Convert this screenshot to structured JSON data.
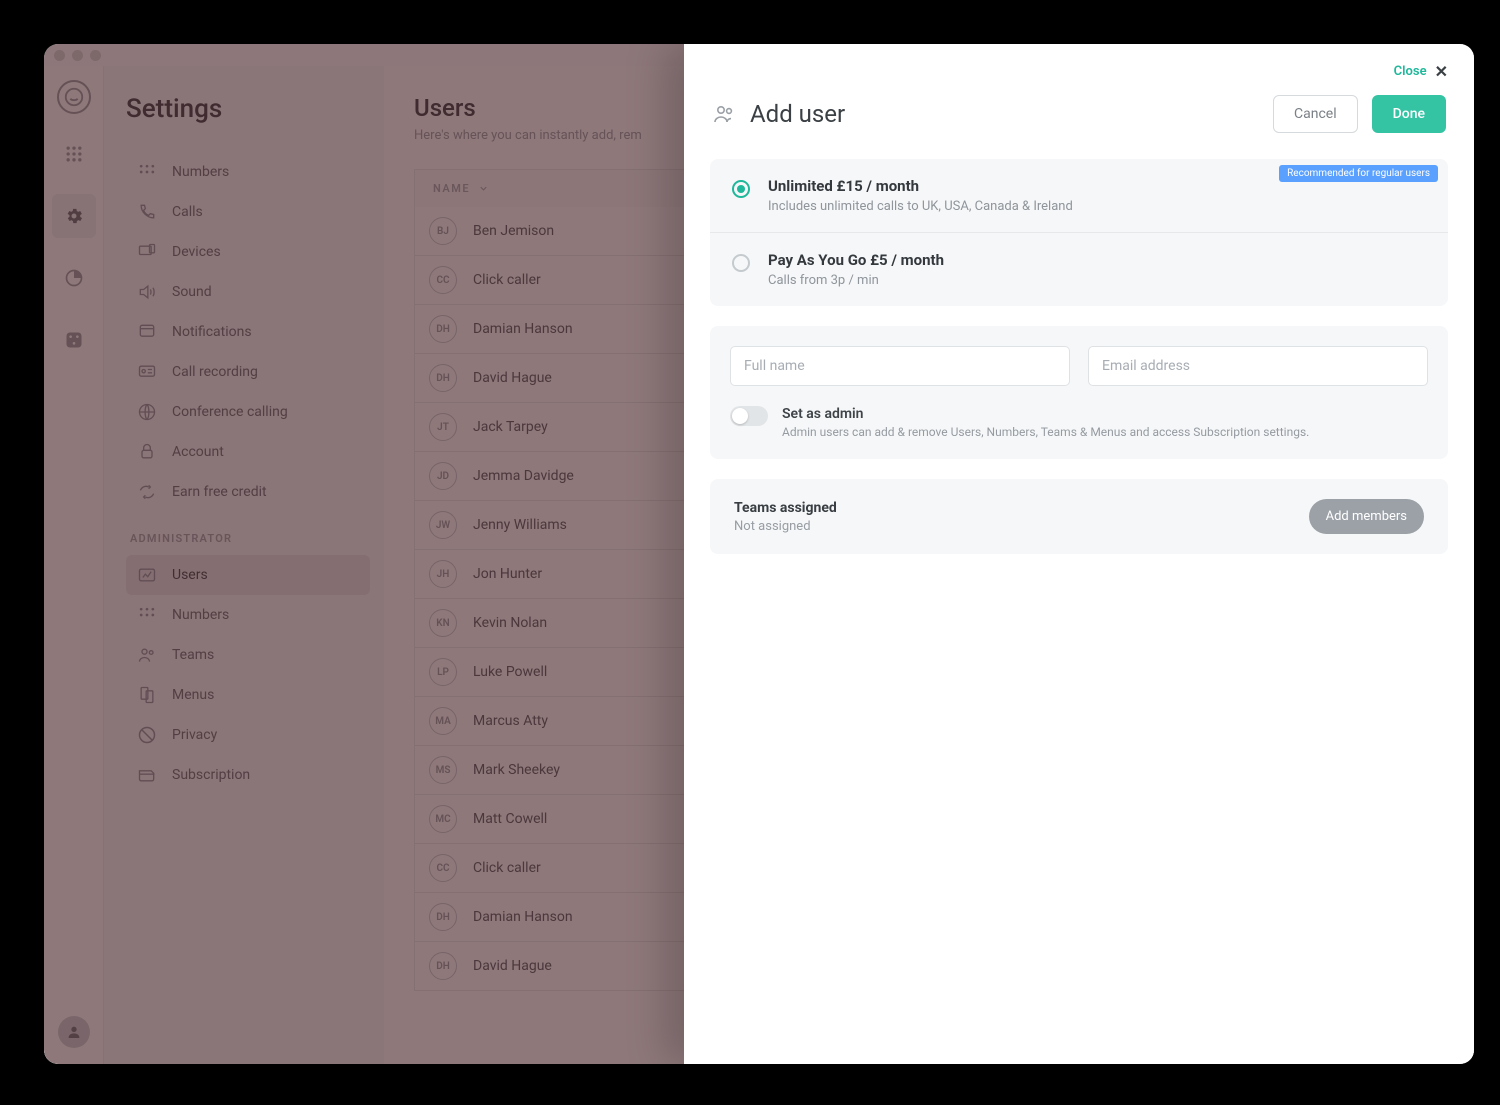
{
  "settings": {
    "title": "Settings",
    "items": [
      "Numbers",
      "Calls",
      "Devices",
      "Sound",
      "Notifications",
      "Call recording",
      "Conference calling",
      "Account",
      "Earn free credit"
    ],
    "admin_label": "ADMINISTRATOR",
    "admin_items": [
      "Users",
      "Numbers",
      "Teams",
      "Menus",
      "Privacy",
      "Subscription"
    ],
    "admin_active_index": 0
  },
  "users_page": {
    "title": "Users",
    "subtitle": "Here's where you can instantly add, rem",
    "column_header": "NAME",
    "rows": [
      {
        "initials": "BJ",
        "name": "Ben Jemison"
      },
      {
        "initials": "CC",
        "name": "Click caller"
      },
      {
        "initials": "DH",
        "name": "Damian Hanson"
      },
      {
        "initials": "DH",
        "name": "David Hague"
      },
      {
        "initials": "JT",
        "name": "Jack Tarpey"
      },
      {
        "initials": "JD",
        "name": "Jemma Davidge"
      },
      {
        "initials": "JW",
        "name": "Jenny Williams"
      },
      {
        "initials": "JH",
        "name": "Jon Hunter"
      },
      {
        "initials": "KN",
        "name": "Kevin Nolan"
      },
      {
        "initials": "LP",
        "name": "Luke Powell"
      },
      {
        "initials": "MA",
        "name": "Marcus Atty"
      },
      {
        "initials": "MS",
        "name": "Mark Sheekey"
      },
      {
        "initials": "MC",
        "name": "Matt Cowell"
      },
      {
        "initials": "CC",
        "name": "Click caller"
      },
      {
        "initials": "DH",
        "name": "Damian Hanson"
      },
      {
        "initials": "DH",
        "name": "David Hague"
      }
    ]
  },
  "modal": {
    "close": "Close",
    "title": "Add user",
    "cancel": "Cancel",
    "done": "Done",
    "recommended_badge": "Recommended for regular users",
    "plans": [
      {
        "title": "Unlimited £15 / month",
        "desc": "Includes unlimited calls to UK, USA, Canada & Ireland",
        "selected": true
      },
      {
        "title": "Pay As You Go £5 / month",
        "desc": "Calls from 3p / min",
        "selected": false
      }
    ],
    "fullname_placeholder": "Full name",
    "email_placeholder": "Email address",
    "admin_toggle_label": "Set as admin",
    "admin_toggle_desc": "Admin users can add & remove Users, Numbers, Teams & Menus and access Subscription settings.",
    "teams_title": "Teams assigned",
    "teams_desc": "Not assigned",
    "add_members": "Add members"
  }
}
